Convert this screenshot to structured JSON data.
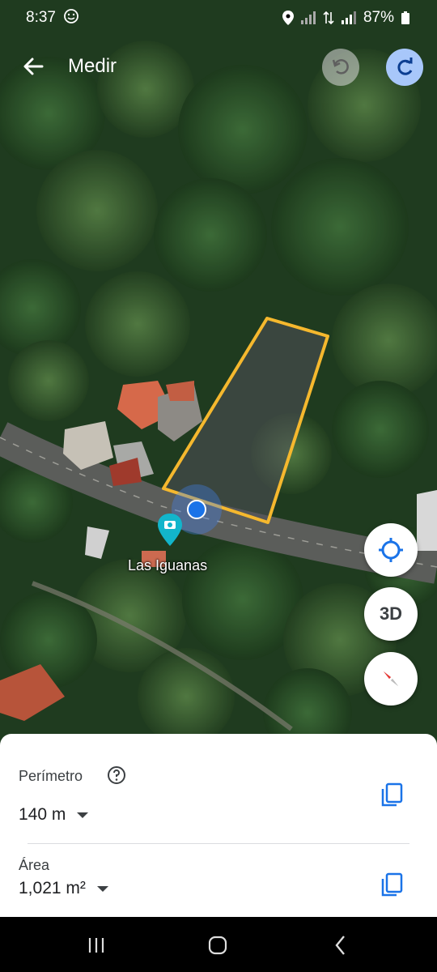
{
  "status_bar": {
    "time": "8:37",
    "battery": "87%"
  },
  "header": {
    "title": "Medir"
  },
  "map": {
    "place_label": "Las Iguanas",
    "polygon_color": "#f5b82e",
    "three_d_label": "3D"
  },
  "measurements": {
    "perimeter": {
      "label": "Perímetro",
      "value": "140 m"
    },
    "area": {
      "label": "Área",
      "value": "1,021 m²"
    }
  },
  "colors": {
    "accent": "#1a73e8",
    "redo_bg": "#a8c7fa"
  }
}
